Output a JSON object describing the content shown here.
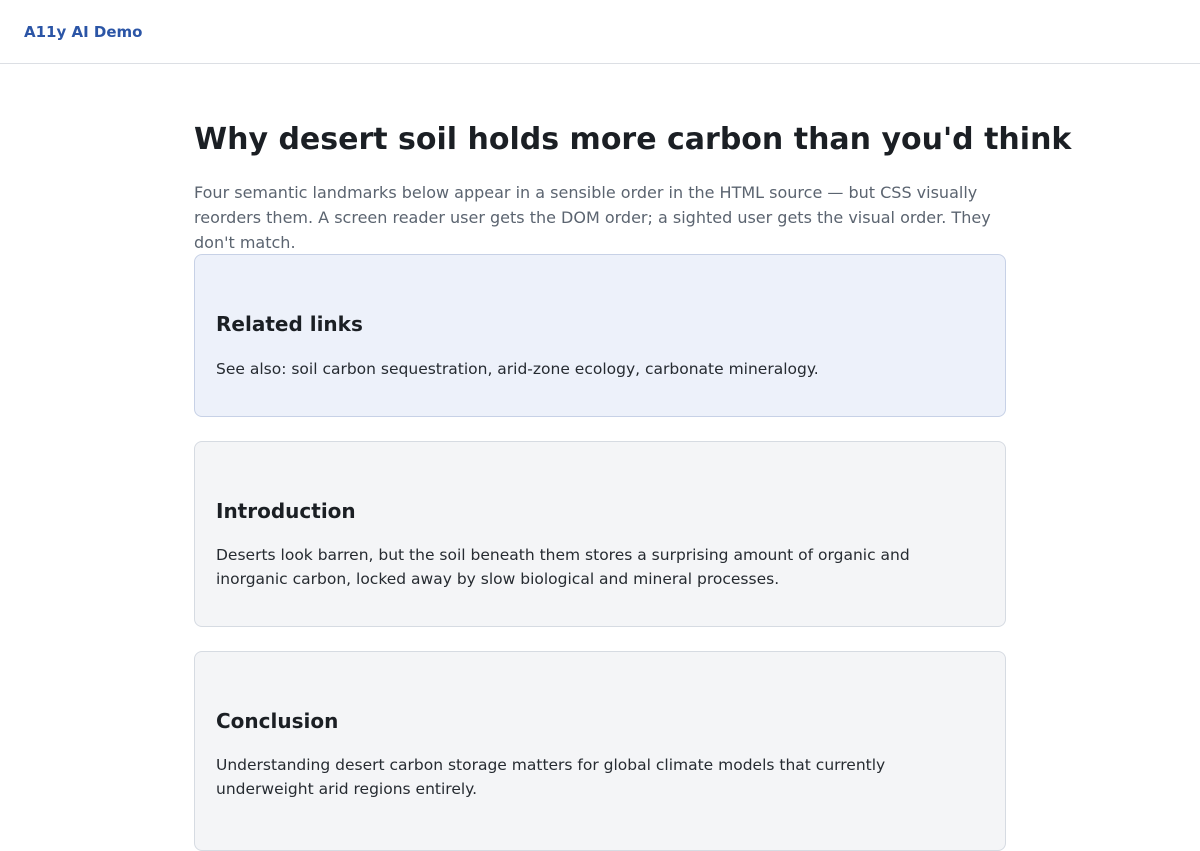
{
  "header": {
    "brand": "A11y AI Demo"
  },
  "main": {
    "title": "Why desert soil holds more carbon than you'd think",
    "description": "Four semantic landmarks below appear in a sensible order in the HTML source — but CSS visually reorders them. A screen reader user gets the DOM order; a sighted user gets the visual order. They don't match.",
    "sections": [
      {
        "heading": "Related links",
        "text": "See also: soil carbon sequestration, arid-zone ecology, carbonate mineralogy."
      },
      {
        "heading": "Introduction",
        "text": "Deserts look barren, but the soil beneath them stores a surprising amount of organic and inorganic carbon, locked away by slow biological and mineral processes."
      },
      {
        "heading": "Conclusion",
        "text": "Understanding desert carbon storage matters for global climate models that currently underweight arid regions entirely."
      }
    ]
  },
  "colors": {
    "brand": "#2b55a6",
    "related_background": "#edf1fa",
    "card_background": "#f4f5f7",
    "border": "#d6dbe2"
  }
}
